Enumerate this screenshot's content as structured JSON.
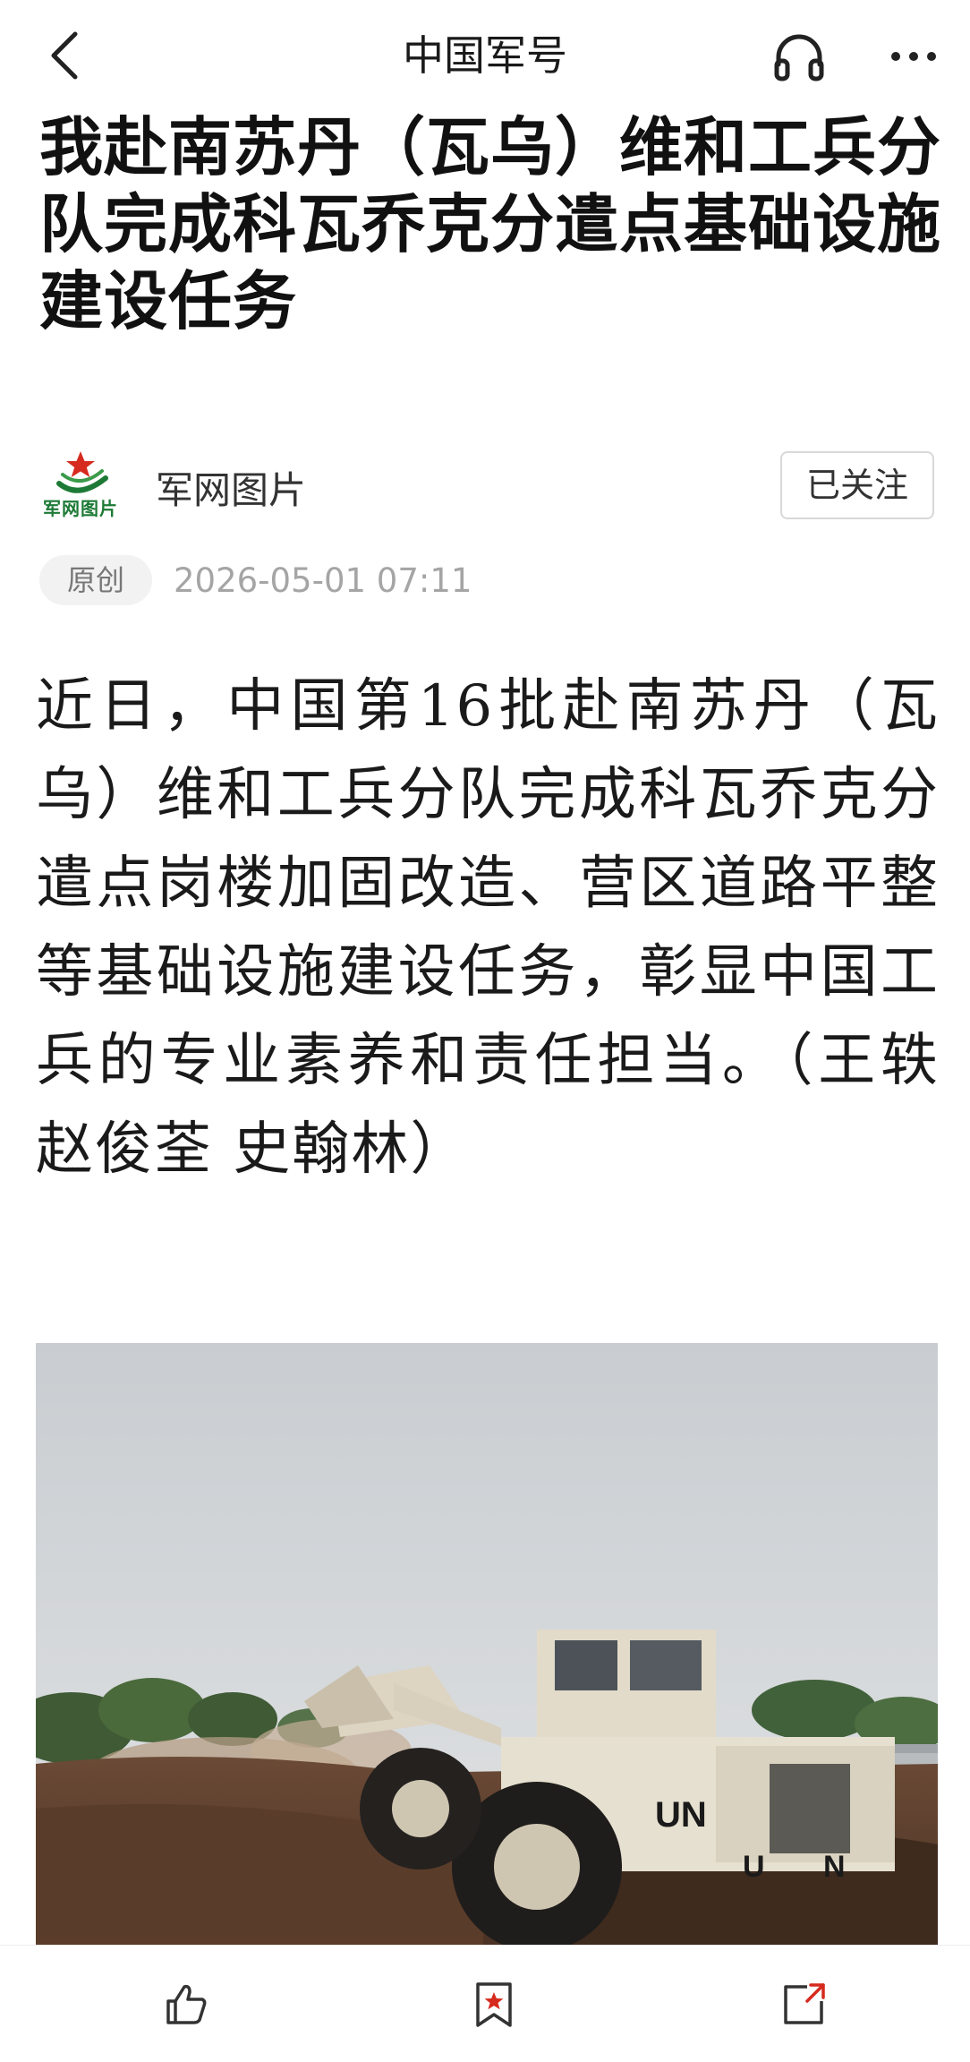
{
  "topbar": {
    "title": "中国军号",
    "back_icon": "chevron-left-icon",
    "audio_icon": "headphones-icon",
    "more_icon": "more-dots-icon"
  },
  "article": {
    "headline": "我赴南苏丹（瓦乌）维和工兵分队完成科瓦乔克分遣点基础设施建设任务",
    "author": {
      "name": "军网图片",
      "logo_text": "军网图片",
      "follow_label": "已关注"
    },
    "meta": {
      "badge": "原创",
      "published": "2026-05-01 07:11"
    },
    "body": "近日，中国第16批赴南苏丹（瓦乌）维和工兵分队完成科瓦乔克分遣点岗楼加固改造、营区道路平整等基础设施建设任务，彰显中国工兵的专业素养和责任担当。（王轶 赵俊荃 史翰林）",
    "photo": {
      "vehicle_marking": "UN"
    }
  },
  "bottombar": {
    "like_icon": "thumbs-up-icon",
    "favorite_icon": "bookmark-star-icon",
    "share_icon": "share-icon"
  },
  "colors": {
    "logo_green": "#1d7a36",
    "logo_red": "#d62a1e",
    "meta_gray": "#a5a5a5",
    "bookmark_red": "#d62a1e"
  }
}
